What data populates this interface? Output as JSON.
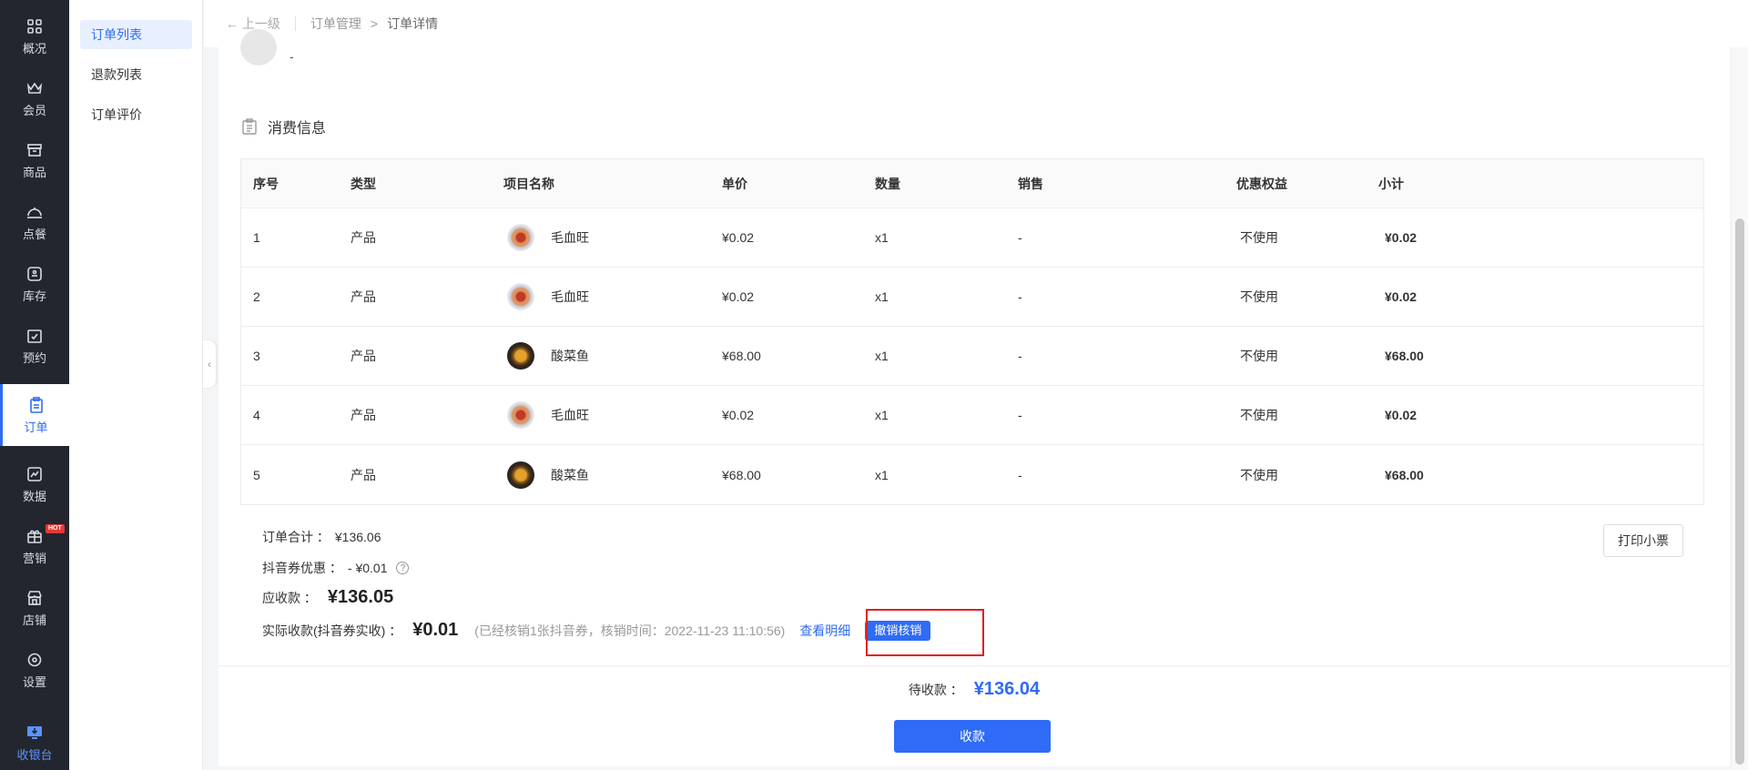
{
  "nav": {
    "items": [
      {
        "label": "概况",
        "icon": "grid-icon"
      },
      {
        "label": "会员",
        "icon": "crown-icon"
      },
      {
        "label": "商品",
        "icon": "store-box-icon"
      },
      {
        "label": "点餐",
        "icon": "cloche-icon"
      },
      {
        "label": "库存",
        "icon": "inventory-icon"
      },
      {
        "label": "预约",
        "icon": "calendar-check-icon"
      },
      {
        "label": "订单",
        "icon": "clipboard-icon"
      },
      {
        "label": "数据",
        "icon": "chart-icon"
      },
      {
        "label": "营销",
        "icon": "gift-icon"
      },
      {
        "label": "店铺",
        "icon": "shop-icon"
      },
      {
        "label": "设置",
        "icon": "gear-icon"
      },
      {
        "label": "收银台",
        "icon": "cashier-icon"
      }
    ],
    "hot_badge": "HOT",
    "accent": "#2f6bf6"
  },
  "submenu": {
    "items": [
      "订单列表",
      "退款列表",
      "订单评价"
    ]
  },
  "breadcrumb": {
    "back": "上一级",
    "parent": "订单管理",
    "sep": ">",
    "current": "订单详情"
  },
  "card": {
    "dash": "-",
    "section_title": "消费信息"
  },
  "table": {
    "headers": [
      "序号",
      "类型",
      "项目名称",
      "单价",
      "数量",
      "销售",
      "优惠权益",
      "小计"
    ],
    "rows": [
      {
        "no": "1",
        "type": "产品",
        "name": "毛血旺",
        "price": "¥0.02",
        "qty": "x1",
        "sales": "-",
        "benefit": "不使用",
        "subtotal": "¥0.02"
      },
      {
        "no": "2",
        "type": "产品",
        "name": "毛血旺",
        "price": "¥0.02",
        "qty": "x1",
        "sales": "-",
        "benefit": "不使用",
        "subtotal": "¥0.02"
      },
      {
        "no": "3",
        "type": "产品",
        "name": "酸菜鱼",
        "price": "¥68.00",
        "qty": "x1",
        "sales": "-",
        "benefit": "不使用",
        "subtotal": "¥68.00"
      },
      {
        "no": "4",
        "type": "产品",
        "name": "毛血旺",
        "price": "¥0.02",
        "qty": "x1",
        "sales": "-",
        "benefit": "不使用",
        "subtotal": "¥0.02"
      },
      {
        "no": "5",
        "type": "产品",
        "name": "酸菜鱼",
        "price": "¥68.00",
        "qty": "x1",
        "sales": "-",
        "benefit": "不使用",
        "subtotal": "¥68.00"
      }
    ]
  },
  "summary": {
    "order_total_label": "订单合计 ：",
    "order_total": "¥136.06",
    "douyin_discount_label": "抖音券优惠 ：",
    "douyin_discount": "- ¥0.01",
    "help": "?",
    "receivable_label": "应收款 ：",
    "receivable": "¥136.05",
    "actual_label": "实际收款(抖音券实收) ：",
    "actual": "¥0.01",
    "actual_note": "(已经核销1张抖音券，核销时间：2022-11-23 11:10:56)",
    "view_detail": "查看明细",
    "revoke_button": "撤销核销",
    "print_button": "打印小票"
  },
  "footer": {
    "pending_label": "待收款 ：",
    "pending_amount": "¥136.04",
    "collect_button": "收款"
  }
}
